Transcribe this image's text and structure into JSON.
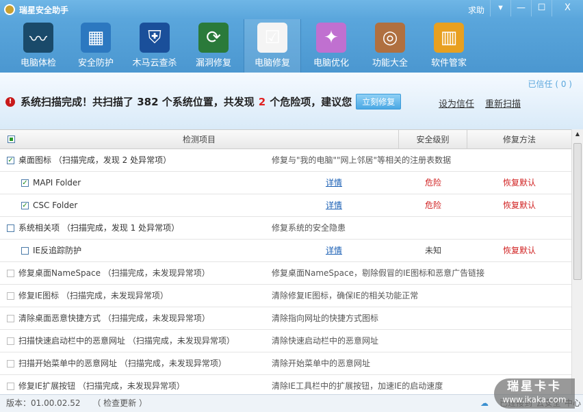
{
  "window": {
    "title": "瑞星安全助手",
    "help": "求助",
    "buttons": [
      "▾",
      "—",
      "☐",
      "X"
    ]
  },
  "toolbar": [
    {
      "label": "电脑体检",
      "icon": "monitor-pulse-icon"
    },
    {
      "label": "安全防护",
      "icon": "firewall-icon"
    },
    {
      "label": "木马云查杀",
      "icon": "shield-icon"
    },
    {
      "label": "漏洞修复",
      "icon": "windows-update-icon"
    },
    {
      "label": "电脑修复",
      "icon": "checklist-icon",
      "active": true
    },
    {
      "label": "电脑优化",
      "icon": "monitor-wand-icon"
    },
    {
      "label": "功能大全",
      "icon": "disc-icon"
    },
    {
      "label": "软件管家",
      "icon": "software-box-icon"
    }
  ],
  "scan": {
    "trusted": "已信任 ( 0 )",
    "msg_a": "系统扫描完成！共扫描了 382 个系统位置，共发现",
    "count": "2",
    "msg_b": "个危险项，建议您",
    "fix_now": "立刻修复",
    "set_trust": "设为信任",
    "rescan": "重新扫描"
  },
  "table": {
    "headers": [
      "检测项目",
      "安全级别",
      "修复方法"
    ],
    "rows": [
      {
        "type": "group",
        "checked": true,
        "name": "桌面图标 （扫描完成，发现 2 处异常项）",
        "desc": "修复与\"我的电脑\"\"网上邻居\"等相关的注册表数据"
      },
      {
        "type": "sub",
        "checked": true,
        "name": "MAPI Folder",
        "detail": "详情",
        "level": "危险",
        "fix": "恢复默认"
      },
      {
        "type": "sub",
        "checked": true,
        "name": "CSC Folder",
        "detail": "详情",
        "level": "危险",
        "fix": "恢复默认"
      },
      {
        "type": "group",
        "checked": false,
        "name": "系统相关项 （扫描完成，发现 1 处异常项）",
        "desc": "修复系统的安全隐患"
      },
      {
        "type": "sub",
        "checked": false,
        "name": "IE反追踪防护",
        "detail": "详情",
        "level": "未知",
        "fix": "恢复默认"
      },
      {
        "type": "grey",
        "name": "修复桌面NameSpace （扫描完成，未发现异常项）",
        "desc": "修复桌面NameSpace，剔除假冒的IE图标和恶意广告链接"
      },
      {
        "type": "grey",
        "name": "修复IE图标 （扫描完成，未发现异常项）",
        "desc": "清除修复IE图标，确保IE的相关功能正常"
      },
      {
        "type": "grey",
        "name": "清除桌面恶意快捷方式 （扫描完成，未发现异常项）",
        "desc": "清除指向网址的快捷方式图标"
      },
      {
        "type": "grey",
        "name": "扫描快速启动栏中的恶意网址 （扫描完成，未发现异常项）",
        "desc": "清除快速启动栏中的恶意网址"
      },
      {
        "type": "grey",
        "name": "扫描开始菜单中的恶意网址 （扫描完成，未发现异常项）",
        "desc": "清除开始菜单中的恶意网址"
      },
      {
        "type": "grey",
        "name": "修复IE扩展按钮 （扫描完成，未发现异常项）",
        "desc": "清除IE工具栏中的扩展按钮，加速IE的启动速度"
      }
    ]
  },
  "footer": {
    "version": "版本：01.00.02.52",
    "check_update": "（ 检查更新 ）",
    "cloud": "已连接到\"云安全\"中心"
  },
  "watermark": {
    "brand": "瑞星卡卡",
    "url": "www.ikaka.com"
  }
}
